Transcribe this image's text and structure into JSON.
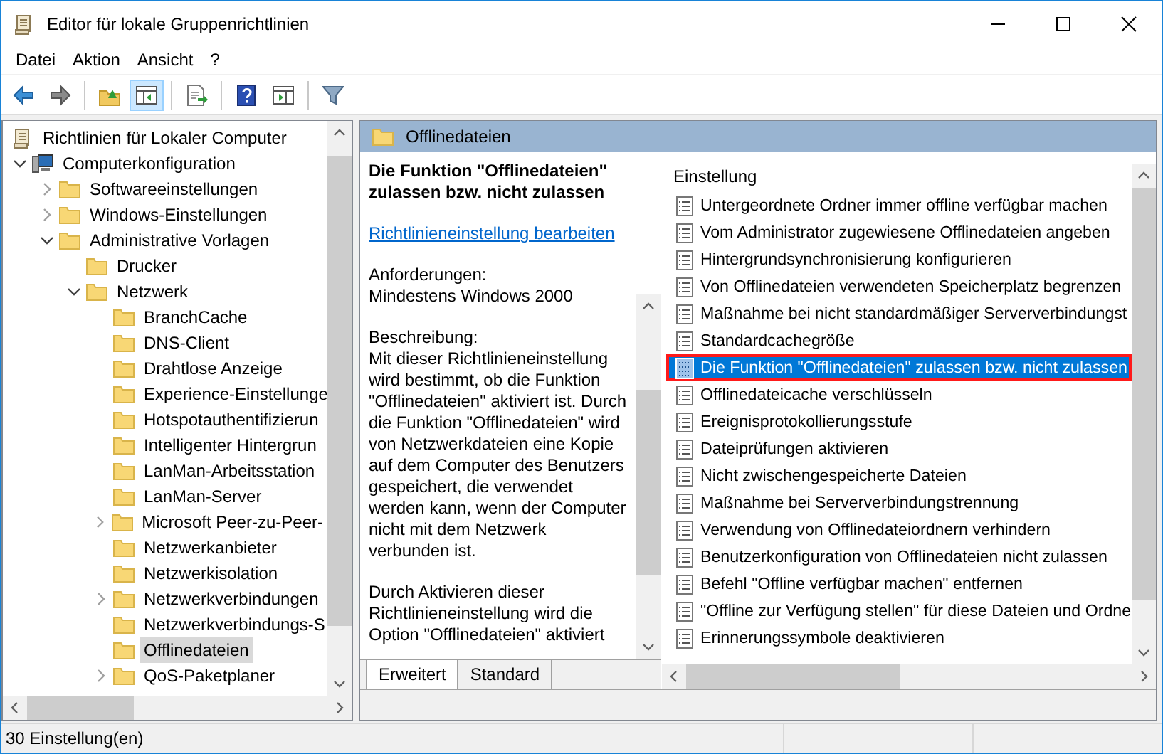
{
  "window": {
    "title": "Editor für lokale Gruppenrichtlinien"
  },
  "menu": [
    "Datei",
    "Aktion",
    "Ansicht",
    "?"
  ],
  "toolbar": [
    {
      "kind": "back",
      "pressed": false
    },
    {
      "kind": "forward",
      "pressed": false
    },
    {
      "kind": "sep"
    },
    {
      "kind": "up",
      "pressed": false
    },
    {
      "kind": "tree",
      "pressed": true
    },
    {
      "kind": "sep"
    },
    {
      "kind": "export",
      "pressed": false
    },
    {
      "kind": "sep"
    },
    {
      "kind": "help",
      "pressed": false
    },
    {
      "kind": "pane",
      "pressed": false
    },
    {
      "kind": "sep"
    },
    {
      "kind": "filter",
      "pressed": false
    }
  ],
  "tree": [
    {
      "label": "Richtlinien für Lokaler Computer",
      "kind": "policy",
      "selected": false,
      "children": [
        {
          "label": "Computerkonfiguration",
          "kind": "computer",
          "selected": false,
          "expanded": true,
          "children": [
            {
              "label": "Softwareeinstellungen",
              "kind": "folder",
              "selected": false,
              "expanded": false
            },
            {
              "label": "Windows-Einstellungen",
              "kind": "folder",
              "selected": false,
              "expanded": false
            },
            {
              "label": "Administrative Vorlagen",
              "kind": "folder",
              "selected": false,
              "expanded": true,
              "children": [
                {
                  "label": "Drucker",
                  "kind": "folder",
                  "selected": false
                },
                {
                  "label": "Netzwerk",
                  "kind": "folder",
                  "selected": false,
                  "expanded": true,
                  "children": [
                    {
                      "label": "BranchCache",
                      "kind": "folder",
                      "selected": false
                    },
                    {
                      "label": "DNS-Client",
                      "kind": "folder",
                      "selected": false
                    },
                    {
                      "label": "Drahtlose Anzeige",
                      "kind": "folder",
                      "selected": false
                    },
                    {
                      "label": "Experience-Einstellunge",
                      "kind": "folder",
                      "selected": false
                    },
                    {
                      "label": "Hotspotauthentifizierun",
                      "kind": "folder",
                      "selected": false
                    },
                    {
                      "label": "Intelligenter Hintergrun",
                      "kind": "folder",
                      "selected": false
                    },
                    {
                      "label": "LanMan-Arbeitsstation",
                      "kind": "folder",
                      "selected": false
                    },
                    {
                      "label": "LanMan-Server",
                      "kind": "folder",
                      "selected": false
                    },
                    {
                      "label": "Microsoft Peer-zu-Peer-",
                      "kind": "folder",
                      "selected": false,
                      "expanded": false
                    },
                    {
                      "label": "Netzwerkanbieter",
                      "kind": "folder",
                      "selected": false
                    },
                    {
                      "label": "Netzwerkisolation",
                      "kind": "folder",
                      "selected": false
                    },
                    {
                      "label": "Netzwerkverbindungen",
                      "kind": "folder",
                      "selected": false,
                      "expanded": false
                    },
                    {
                      "label": "Netzwerkverbindungs-S",
                      "kind": "folder",
                      "selected": false
                    },
                    {
                      "label": "Offlinedateien",
                      "kind": "folder",
                      "selected": true
                    },
                    {
                      "label": "QoS-Paketplaner",
                      "kind": "folder",
                      "selected": false,
                      "expanded": false
                    }
                  ]
                }
              ]
            }
          ]
        }
      ]
    }
  ],
  "details": {
    "header": "Offlinedateien",
    "title": "Die Funktion \"Offlinedateien\" zulassen bzw. nicht zulassen",
    "link": "Richtlinieneinstellung bearbeiten",
    "paragraphs": [
      [
        "Anforderungen:",
        "Mindestens Windows 2000"
      ],
      [
        "Beschreibung:",
        "Mit dieser Richtlinieneinstellung wird bestimmt, ob die Funktion \"Offlinedateien\" aktiviert ist. Durch die Funktion \"Offlinedateien\" wird von Netzwerkdateien eine Kopie auf dem Computer des Benutzers gespeichert, die verwendet werden kann, wenn der Computer nicht mit dem Netzwerk verbunden ist."
      ],
      [
        "Durch Aktivieren dieser Richtlinieneinstellung wird die Option \"Offlinedateien\" aktiviert"
      ]
    ],
    "tabs": [
      {
        "label": "Erweitert",
        "selected": true
      },
      {
        "label": "Standard",
        "selected": false
      }
    ]
  },
  "settings": {
    "column": "Einstellung",
    "rows": [
      {
        "label": "Untergeordnete Ordner immer offline verfügbar machen",
        "selected": false
      },
      {
        "label": "Vom Administrator zugewiesene Offlinedateien angeben",
        "selected": false
      },
      {
        "label": "Hintergrundsynchronisierung konfigurieren",
        "selected": false
      },
      {
        "label": "Von Offlinedateien verwendeten Speicherplatz begrenzen",
        "selected": false
      },
      {
        "label": "Maßnahme bei nicht standardmäßiger Serververbindungst",
        "selected": false
      },
      {
        "label": "Standardcachegröße",
        "selected": false
      },
      {
        "label": "Die Funktion \"Offlinedateien\" zulassen bzw. nicht zulassen",
        "selected": true
      },
      {
        "label": "Offlinedateicache verschlüsseln",
        "selected": false
      },
      {
        "label": "Ereignisprotokollierungsstufe",
        "selected": false
      },
      {
        "label": "Dateiprüfungen aktivieren",
        "selected": false
      },
      {
        "label": "Nicht zwischengespeicherte Dateien",
        "selected": false
      },
      {
        "label": "Maßnahme bei Serververbindungstrennung",
        "selected": false
      },
      {
        "label": "Verwendung von Offlinedateiordnern verhindern",
        "selected": false
      },
      {
        "label": "Benutzerkonfiguration von Offlinedateien nicht zulassen",
        "selected": false
      },
      {
        "label": "Befehl \"Offline verfügbar machen\" entfernen",
        "selected": false
      },
      {
        "label": "\"Offline zur Verfügung stellen\" für diese Dateien und Ordne",
        "selected": false
      },
      {
        "label": "Erinnerungssymbole deaktivieren",
        "selected": false
      }
    ]
  },
  "status_bar": "30 Einstellung(en)"
}
